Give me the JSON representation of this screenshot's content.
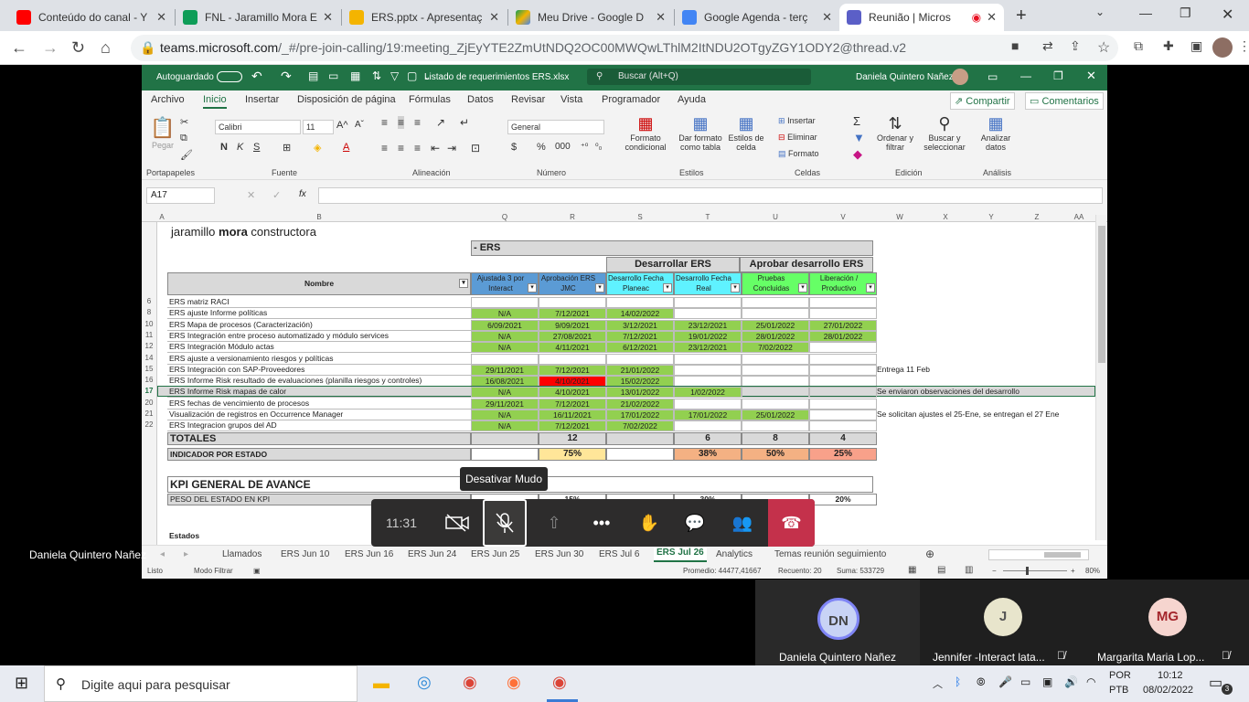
{
  "browser": {
    "tabs": [
      {
        "title": "Conteúdo do canal - Y",
        "color": "#ff0000"
      },
      {
        "title": "FNL - Jaramillo Mora E",
        "color": "#0f9d58"
      },
      {
        "title": "ERS.pptx - Apresentaç",
        "color": "#f4b400"
      },
      {
        "title": "Meu Drive - Google D",
        "color": "#4285f4"
      },
      {
        "title": "Google Agenda - terç",
        "color": "#4285f4"
      },
      {
        "title": "Reunião | Micros",
        "color": "#5b5fc7"
      }
    ],
    "url_domain": "teams.microsoft.com",
    "url_path": "/_#/pre-join-calling/19:meeting_ZjEyYTE2ZmUtNDQ2OC00MWQwLThlM2ItNDU2OTgyZGY1ODY2@thread.v2"
  },
  "excel": {
    "autosave": "Autoguardado",
    "filename": "Listado de requerimientos ERS.xlsx",
    "search": "Buscar (Alt+Q)",
    "user": "Daniela Quintero Nañez",
    "menu": [
      "Archivo",
      "Inicio",
      "Insertar",
      "Disposición de página",
      "Fórmulas",
      "Datos",
      "Revisar",
      "Vista",
      "Programador",
      "Ayuda"
    ],
    "share": "Compartir",
    "comments": "Comentarios",
    "ribbon": {
      "paste": "Pegar",
      "font": "Calibri",
      "size": "11",
      "numfmt": "General",
      "cond": "Formato condicional",
      "astable": "Dar formato como tabla",
      "cellstyles": "Estilos de celda",
      "insert": "Insertar",
      "delete": "Eliminar",
      "format": "Formato",
      "sort": "Ordenar y filtrar",
      "find": "Buscar y seleccionar",
      "analyze": "Analizar datos",
      "groups": [
        "Portapapeles",
        "Fuente",
        "Alineación",
        "Número",
        "Estilos",
        "Celdas",
        "Edición",
        "Análisis"
      ]
    },
    "namebox": "A17",
    "cols": [
      "A",
      "B",
      "Q",
      "R",
      "S",
      "T",
      "U",
      "V",
      "W",
      "X",
      "Y",
      "Z",
      "AA"
    ],
    "company": "jaramillo ",
    "company_bold": "mora",
    "company_rest": " constructora",
    "banner": "- ERS",
    "h_dev": "Desarrollar ERS",
    "h_appr": "Aprobar desarrollo ERS",
    "h_name": "Nombre",
    "h_cols": [
      "Ajustada 3 por Interact",
      "Aprobación ERS JMC",
      "Desarrollo Fecha Planeac",
      "Desarrollo Fecha Real",
      "Pruebas Concluidas",
      "Liberación / Productivo"
    ],
    "rows": [
      {
        "n": "6",
        "name": "ERS matriz RACI",
        "v": [
          "",
          "",
          "",
          "",
          "",
          ""
        ]
      },
      {
        "n": "8",
        "name": "ERS ajuste Informe políticas",
        "v": [
          "N/A",
          "7/12/2021",
          "14/02/2022",
          "",
          "",
          ""
        ]
      },
      {
        "n": "10",
        "name": "ERS Mapa de procesos (Caracterización)",
        "v": [
          "6/09/2021",
          "9/09/2021",
          "3/12/2021",
          "23/12/2021",
          "25/01/2022",
          "27/01/2022"
        ]
      },
      {
        "n": "11",
        "name": "ERS Integración entre proceso automatizado y módulo services",
        "v": [
          "N/A",
          "27/08/2021",
          "7/12/2021",
          "19/01/2022",
          "28/01/2022",
          "28/01/2022"
        ]
      },
      {
        "n": "12",
        "name": "ERS Integración Módulo actas",
        "v": [
          "N/A",
          "4/11/2021",
          "6/12/2021",
          "23/12/2021",
          "7/02/2022",
          ""
        ]
      },
      {
        "n": "14",
        "name": "ERS ajuste a versionamiento riesgos y políticas",
        "v": [
          "",
          "",
          "",
          "",
          "",
          ""
        ]
      },
      {
        "n": "15",
        "name": "ERS Integración con SAP-Proveedores",
        "v": [
          "29/11/2021",
          "7/12/2021",
          "21/01/2022",
          "",
          "",
          ""
        ],
        "note": "Entrega 11 Feb"
      },
      {
        "n": "16",
        "name": "ERS Informe Risk resultado de evaluaciones (planilla riesgos y controles)",
        "v": [
          "16/08/2021",
          "4/10/2021",
          "15/02/2022",
          "",
          "",
          ""
        ]
      },
      {
        "n": "17",
        "name": "ERS Informe Risk mapas de calor",
        "v": [
          "N/A",
          "4/10/2021",
          "13/01/2022",
          "1/02/2022",
          "",
          ""
        ],
        "note": "Se enviaron observaciones del desarrollo"
      },
      {
        "n": "20",
        "name": "ERS fechas de vencimiento de procesos",
        "v": [
          "29/11/2021",
          "7/12/2021",
          "21/02/2022",
          "",
          "",
          ""
        ]
      },
      {
        "n": "21",
        "name": "Visualización de registros en Occurrence Manager",
        "v": [
          "N/A",
          "16/11/2021",
          "17/01/2022",
          "17/01/2022",
          "25/01/2022",
          ""
        ],
        "note": "Se solicitan ajustes el 25-Ene, se entregan el 27 Ene"
      },
      {
        "n": "22",
        "name": "ERS Integracion grupos del AD",
        "v": [
          "N/A",
          "7/12/2021",
          "7/02/2022",
          "",
          "",
          ""
        ]
      }
    ],
    "totals_label": "TOTALES",
    "totals": [
      "",
      "12",
      "",
      "6",
      "8",
      "4"
    ],
    "ind_label": "INDICADOR POR ESTADO",
    "ind": [
      "",
      "75%",
      "",
      "38%",
      "50%",
      "25%"
    ],
    "kpi": "KPI GENERAL DE AVANCE",
    "peso": "PESO DEL ESTADO EN KPI",
    "peso_vals": [
      "",
      "15%",
      "",
      "30%",
      "",
      "20%"
    ],
    "estados": "Estados",
    "sheets": [
      "Llamados",
      "ERS Jun 10",
      "ERS Jun 16",
      "ERS Jun 24",
      "ERS Jun 25",
      "ERS Jun 30",
      "ERS Jul 6",
      "ERS Jul 26",
      "Analytics",
      "Temas reunión seguimiento"
    ],
    "active_sheet": "ERS Jul 26",
    "status": {
      "ready": "Listo",
      "filter": "Modo Filtrar",
      "avg": "Promedio: 44477,41667",
      "count": "Recuento: 20",
      "sum": "Suma: 533729",
      "zoom": "80%"
    }
  },
  "teams": {
    "timer": "11:31",
    "tooltip": "Desativar Mudo",
    "presenter": "Daniela Quintero Nañez",
    "participants": [
      {
        "initials": "DN",
        "name": "Daniela Quintero Nañez",
        "color": "#c8d3f5"
      },
      {
        "initials": "J",
        "name": "Jennifer -Interact lata...",
        "color": "#e8e5cc"
      },
      {
        "initials": "MG",
        "name": "Margarita Maria Lop...",
        "color": "#f6d5cf"
      }
    ]
  },
  "taskbar": {
    "search": "Digite aqui para pesquisar",
    "lang1": "POR",
    "lang2": "PTB",
    "time": "10:12",
    "date": "08/02/2022",
    "badge": "3"
  }
}
